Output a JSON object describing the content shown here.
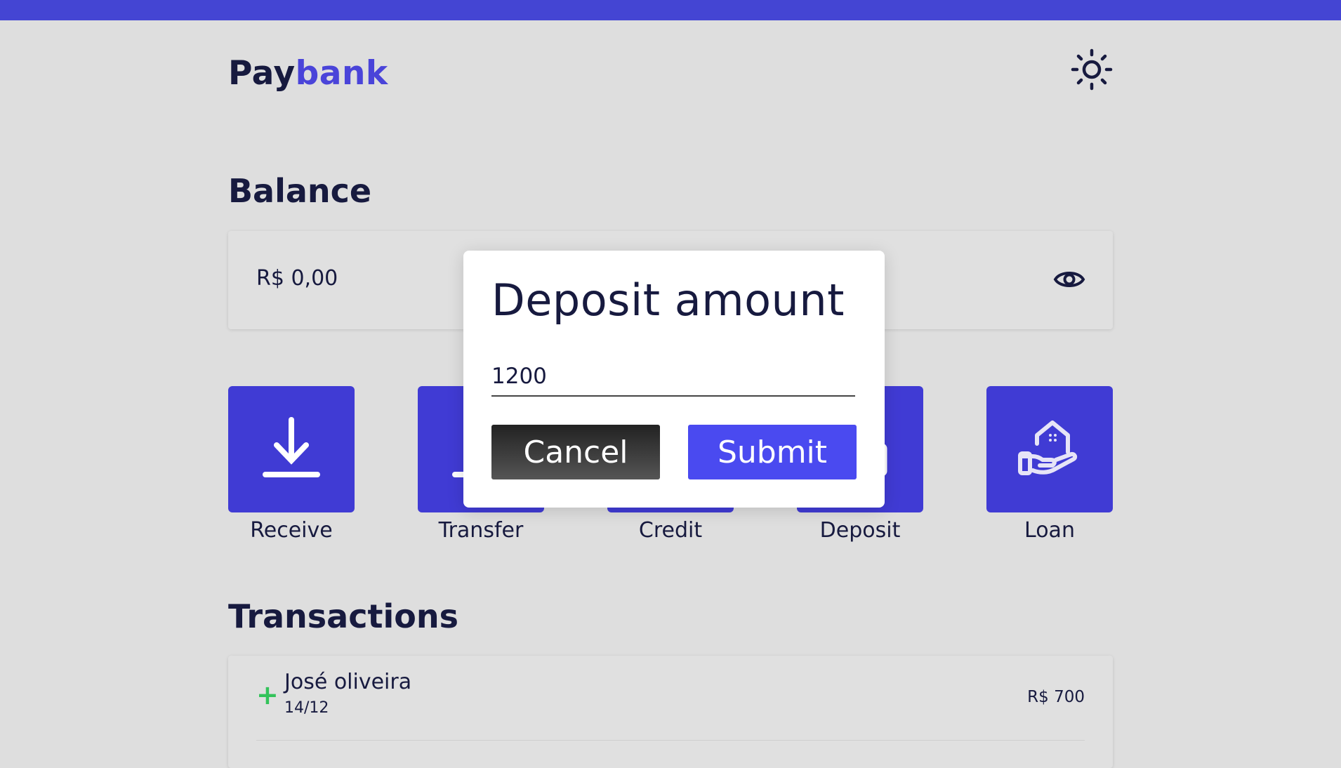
{
  "header": {
    "logo_part1": "Pay",
    "logo_part2": "bank",
    "theme_icon": "sun-icon"
  },
  "balance": {
    "title": "Balance",
    "value": "R$ 0,00",
    "toggle_icon": "eye-icon"
  },
  "actions": [
    {
      "label": "Receive",
      "icon": "download-icon"
    },
    {
      "label": "Transfer",
      "icon": "upload-icon"
    },
    {
      "label": "Credit",
      "icon": "credit-card-icon"
    },
    {
      "label": "Deposit",
      "icon": "deposit-icon"
    },
    {
      "label": "Loan",
      "icon": "hand-house-icon"
    }
  ],
  "transactions": {
    "title": "Transactions",
    "items": [
      {
        "sign": "+",
        "name": "José oliveira",
        "date": "14/12",
        "amount": "R$ 700"
      }
    ]
  },
  "modal": {
    "title": "Deposit amount",
    "input_value": "1200",
    "cancel_label": "Cancel",
    "submit_label": "Submit"
  },
  "colors": {
    "brand": "#4445d3",
    "accent": "#403bd4",
    "positive": "#33c35a",
    "background": "#dedede"
  }
}
